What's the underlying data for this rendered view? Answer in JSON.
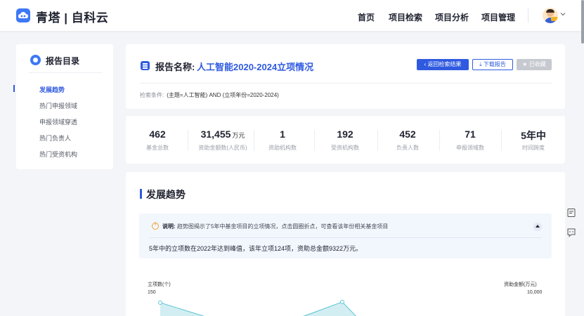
{
  "header": {
    "brand": "青塔 | 自科云",
    "nav": [
      "首页",
      "项目检索",
      "项目分析",
      "项目管理"
    ]
  },
  "sidebar": {
    "title": "报告目录",
    "items": [
      "发展趋势",
      "热门申报领域",
      "申报领域穿透",
      "热门负责人",
      "热门受资机构"
    ],
    "active_index": 0
  },
  "report": {
    "label": "报告名称:",
    "name": "人工智能2020-2024立项情况",
    "buttons": {
      "back": "返回检索结果",
      "download": "下载报告",
      "collected": "已收藏"
    },
    "condition_label": "检索条件:",
    "condition_value": "(主题=人工智能) AND (立项年份=2020-2024)"
  },
  "stats": [
    {
      "value": "462",
      "unit": "",
      "label": "基金总数"
    },
    {
      "value": "31,455",
      "unit": "万元",
      "label": "资助金额数(人民币)"
    },
    {
      "value": "1",
      "unit": "",
      "label": "资助机构数"
    },
    {
      "value": "192",
      "unit": "",
      "label": "受资机构数"
    },
    {
      "value": "452",
      "unit": "",
      "label": "负责人数"
    },
    {
      "value": "71",
      "unit": "",
      "label": "申报领域数"
    },
    {
      "value": "5年中",
      "unit": "",
      "label": "时间跨度"
    }
  ],
  "trend": {
    "title": "发展趋势",
    "note_label": "说明:",
    "note_text": "趋势图揭示了5年中基金项目的立项情况，点击圆圈折点，可查看该年份相关基金项目",
    "summary": "5年中的立项数在2022年达到峰值，该年立项124项，资助总金额9322万元。"
  },
  "chart_data": {
    "type": "line",
    "ylabel": "立项数(个)",
    "y2label": "资助金额(万元)",
    "ylim": [
      0,
      150
    ],
    "y2lim": [
      0,
      10000
    ],
    "y_top_tick": "150",
    "y2_top_tick": "10,000"
  },
  "colors": {
    "accent": "#2f5ae0",
    "chart_line": "#5ec6d6",
    "chart_fill": "#d3eef2"
  }
}
